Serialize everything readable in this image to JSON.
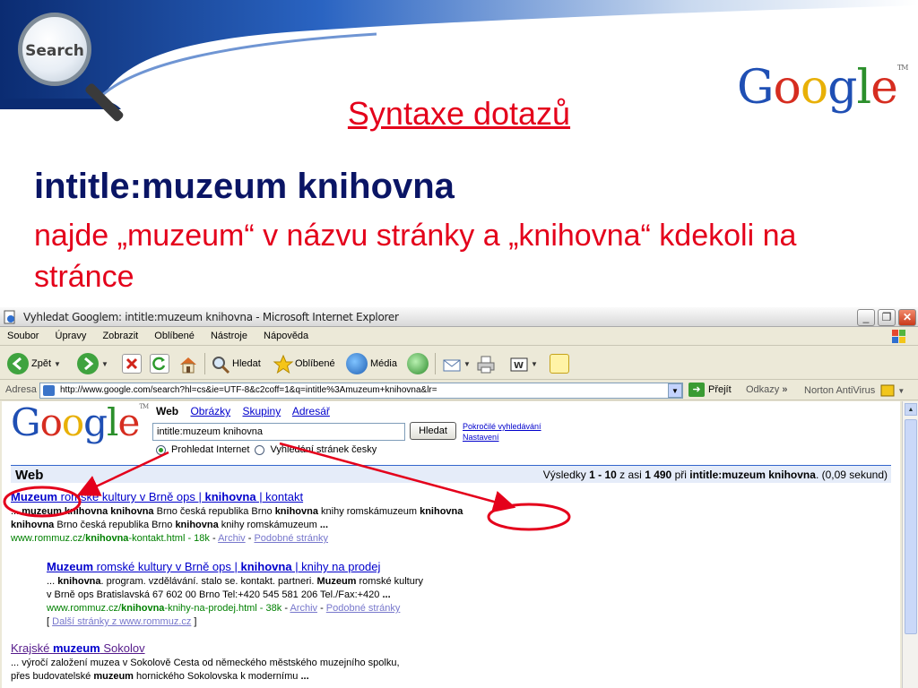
{
  "slide": {
    "title": "Syntaxe dotazů",
    "query": "intitle:muzeum knihovna",
    "description": "najde „muzeum“ v názvu stránky a „knihovna“ kdekoli na stránce",
    "search_logo_text": "Search",
    "google_logo": "Google",
    "google_logo_tm": "TM"
  },
  "browser": {
    "window_title": "Vyhledat Googlem: intitle:muzeum knihovna - Microsoft Internet Explorer",
    "menu": [
      "Soubor",
      "Úpravy",
      "Zobrazit",
      "Oblíbené",
      "Nástroje",
      "Nápověda"
    ],
    "toolbar": {
      "back": "Zpět",
      "search": "Hledat",
      "favorites": "Oblíbené",
      "media": "Média"
    },
    "address_label": "Adresa",
    "address_url": "http://www.google.com/search?hl=cs&ie=UTF-8&c2coff=1&q=intitle%3Amuzeum+knihovna&lr=",
    "go_label": "Přejít",
    "links_label": "Odkazy",
    "links_chevron": "»",
    "norton_label": "Norton AntiVirus"
  },
  "google": {
    "logo": "Google",
    "tabs": {
      "active": "Web",
      "images": "Obrázky",
      "groups": "Skupiny",
      "directory": "Adresář"
    },
    "query_value": "intitle:muzeum knihovna",
    "search_button": "Hledat",
    "advanced_link": "Pokročilé vyhledávání",
    "settings_link": "Nastavení",
    "radio_internet": "Prohledat Internet",
    "radio_czech": "Vyhledání stránek česky",
    "web_label": "Web",
    "stats": {
      "prefix": "Výsledky",
      "range": "1 - 10",
      "about": "z asi",
      "total": "1 490",
      "for": "při",
      "query": "intitle:muzeum knihovna",
      "time": "(0,09 sekund)"
    }
  },
  "results": [
    {
      "title_b1": "Muzeum",
      "title_t1": " romské kultury v Brně ops | ",
      "title_b2": "knihovna",
      "title_t2": " | kontakt",
      "snip1_a": "... ",
      "snip1_b1": "muzeum knihovna knihovna",
      "snip1_t1": " Brno česká republika Brno ",
      "snip1_b2": "knihovna",
      "snip1_t2": " knihy romskámuzeum ",
      "snip1_b3": "knihovna",
      "snip2_b1": "knihovna",
      "snip2_t1": " Brno česká republika Brno ",
      "snip2_b2": "knihovna",
      "snip2_t2": " knihy romskámuzeum ",
      "snip2_b3": "...",
      "url_t1": "www.rommuz.cz/",
      "url_b": "knihovna",
      "url_t2": "-kontakt.html",
      "size": "18k",
      "cache": "Archiv",
      "similar": "Podobné stránky"
    },
    {
      "title_b1": "Muzeum",
      "title_t1": " romské kultury v Brně ops | ",
      "title_b2": "knihovna",
      "title_t2": " | knihy na prodej",
      "snip1_a": "... ",
      "snip1_b1": "knihovna",
      "snip1_t1": ". program. vzdělávání. stalo se. kontakt. partneri. ",
      "snip1_b2": "Muzeum",
      "snip1_t2": " romské kultury",
      "snip2_t1": "v Brně ops Bratislavská 67 602 00 Brno Tel:+420 545 581 206 Tel./Fax:+420 ",
      "snip2_b1": "...",
      "url_t1": "www.rommuz.cz/",
      "url_b": "knihovna",
      "url_t2": "-knihy-na-prodej.html",
      "size": "38k",
      "cache": "Archiv",
      "similar": "Podobné stránky",
      "more_label": "Další stránky z www.rommuz.cz"
    },
    {
      "title_t0": "Krajské ",
      "title_b1": "muzeum",
      "title_t1": " Sokolov",
      "snip1": "... výročí založení muzea v Sokolově Cesta od německého městského muzejního spolku,",
      "snip2_t1": "přes budovatelské ",
      "snip2_b1": "muzeum",
      "snip2_t2": " hornického Sokolovska k modernímu ",
      "snip2_b2": "..."
    }
  ],
  "colors": {
    "title_red": "#e4001b",
    "query_navy": "#0a1565",
    "banner_blue": "#1c4fa0",
    "link_blue": "#0000cc",
    "url_green": "#008000",
    "annotation_red": "#e4001b"
  }
}
